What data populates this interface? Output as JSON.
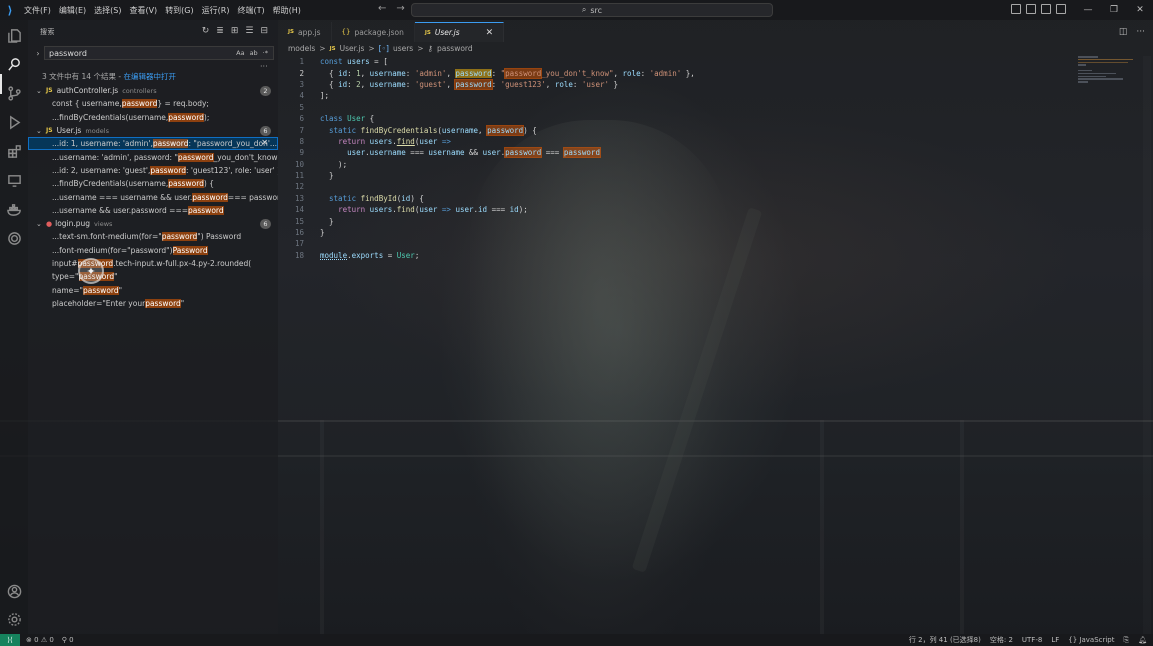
{
  "titlebar": {
    "menu": [
      "文件(F)",
      "编辑(E)",
      "选择(S)",
      "查看(V)",
      "转到(G)",
      "运行(R)",
      "终端(T)",
      "帮助(H)"
    ],
    "command_center": "src"
  },
  "sidebar": {
    "title": "搜索",
    "search_value": "password",
    "options": [
      "Aa",
      "ab",
      "·*"
    ],
    "summary_text": "3 文件中有 14 个结果 - ",
    "summary_link": "在编辑器中打开",
    "files": [
      {
        "name": "authController.js",
        "dir": "controllers",
        "count": "2",
        "type": "js",
        "matches": [
          {
            "pre": "const { username, ",
            "hit": "password",
            "post": " } = req.body;"
          },
          {
            "pre": "...findByCredentials(username, ",
            "hit": "password",
            "post": ");"
          }
        ]
      },
      {
        "name": "User.js",
        "dir": "models",
        "count": "6",
        "type": "js",
        "matches": [
          {
            "pre": "...id: 1, username: 'admin', ",
            "hit": "password",
            "post": ": \"password_you_don'...",
            "selected": true
          },
          {
            "pre": "...username: 'admin', password: \"",
            "hit": "password",
            "post": "_you_don't_know\", rol..."
          },
          {
            "pre": "...id: 2, username: 'guest', ",
            "hit": "password",
            "post": ": 'guest123', role: 'user' }"
          },
          {
            "pre": "...findByCredentials(username, ",
            "hit": "password",
            "post": ") {"
          },
          {
            "pre": "...username === username && user.",
            "hit": "password",
            "post": " === password"
          },
          {
            "pre": "...username && user.password === ",
            "hit": "password",
            "post": ""
          }
        ]
      },
      {
        "name": "login.pug",
        "dir": "views",
        "count": "6",
        "type": "pug",
        "matches": [
          {
            "pre": "...text-sm.font-medium(for=\"",
            "hit": "password",
            "post": "\") Password"
          },
          {
            "pre": "...font-medium(for=\"password\") ",
            "hit": "Password",
            "post": ""
          },
          {
            "pre": "input#",
            "hit": "password",
            "post": ".tech-input.w-full.px-4.py-2.rounded("
          },
          {
            "pre": "type=\"",
            "hit": "password",
            "post": "\""
          },
          {
            "pre": "name=\"",
            "hit": "password",
            "post": "\""
          },
          {
            "pre": "placeholder=\"Enter your ",
            "hit": "password",
            "post": "\""
          }
        ]
      }
    ]
  },
  "tabs": [
    {
      "label": "app.js",
      "icon": "js",
      "active": false
    },
    {
      "label": "package.json",
      "icon": "json",
      "active": false
    },
    {
      "label": "User.js",
      "icon": "js",
      "active": true
    }
  ],
  "breadcrumb": [
    "models",
    ">",
    "User.js",
    ">",
    "users",
    ">",
    "password"
  ],
  "code_lines": [
    "1",
    "2",
    "3",
    "4",
    "5",
    "6",
    "7",
    "8",
    "9",
    "10",
    "11",
    "12",
    "13",
    "14",
    "15",
    "16",
    "17",
    "18"
  ],
  "status": {
    "errors": "0",
    "warnings": "0",
    "ports": "0",
    "position": "行 2，列 41 (已选择8)",
    "spaces": "空格: 2",
    "encoding": "UTF-8",
    "eol": "LF",
    "language": "JavaScript"
  }
}
